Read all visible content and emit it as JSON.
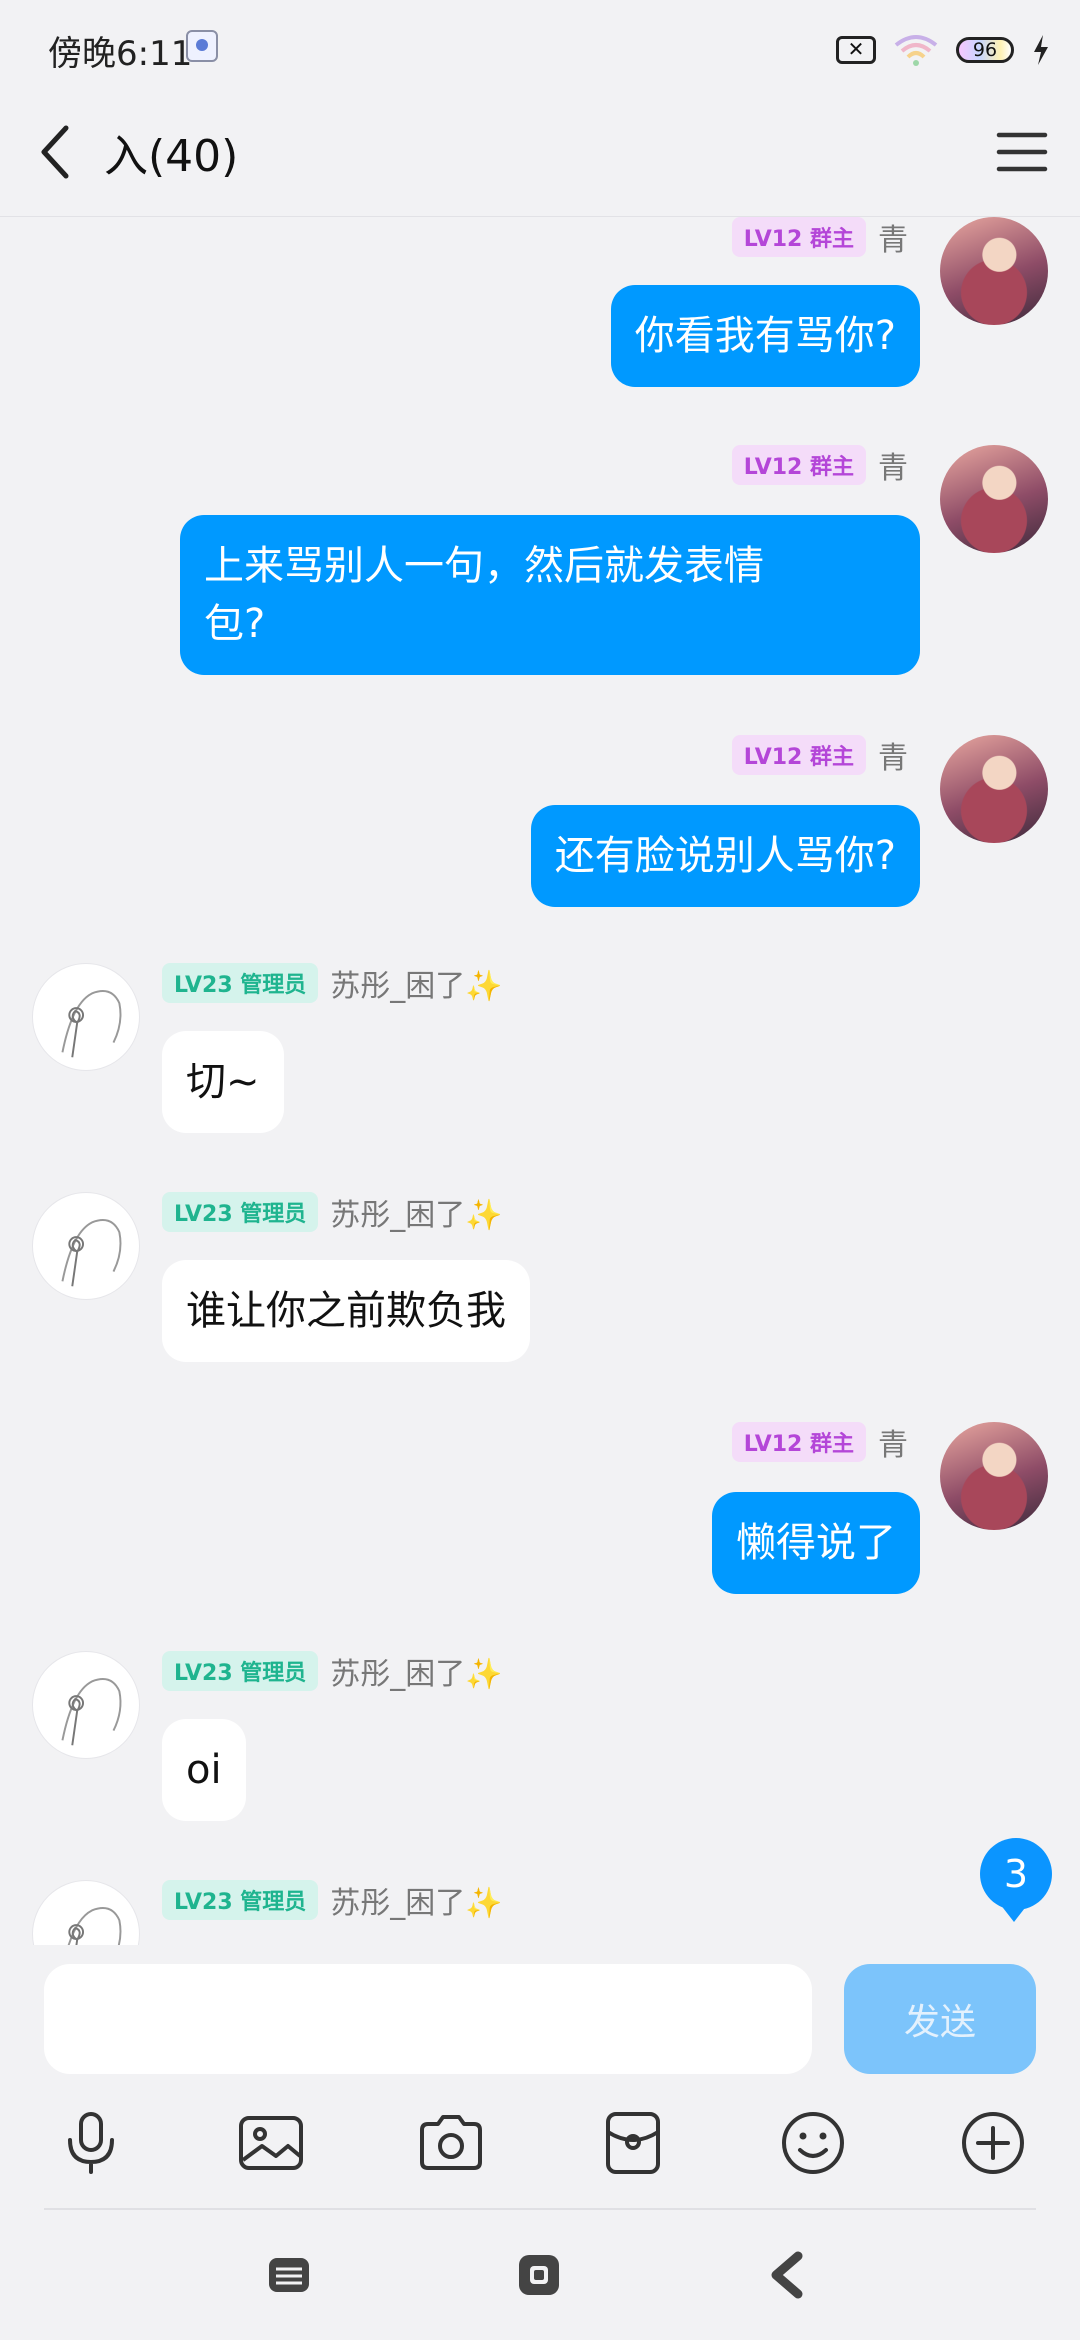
{
  "status": {
    "time": "傍晚6:11",
    "battery": "96"
  },
  "header": {
    "title": "入(40)"
  },
  "messages": [
    {
      "side": "out",
      "badge": "LV12 群主",
      "sender": "青",
      "lines": [
        "你看我有骂你?"
      ]
    },
    {
      "side": "out",
      "badge": "LV12 群主",
      "sender": "青",
      "lines": [
        "上来骂别人一句，然后就发表情",
        "包?"
      ]
    },
    {
      "side": "out",
      "badge": "LV12 群主",
      "sender": "青",
      "lines": [
        "还有脸说别人骂你?"
      ]
    },
    {
      "side": "in",
      "badge": "LV23 管理员",
      "sender": "苏彤_困了✨",
      "lines": [
        "切~"
      ]
    },
    {
      "side": "in",
      "badge": "LV23 管理员",
      "sender": "苏彤_困了✨",
      "lines": [
        "谁让你之前欺负我"
      ]
    },
    {
      "side": "out",
      "badge": "LV12 群主",
      "sender": "青",
      "lines": [
        "懒得说了"
      ]
    },
    {
      "side": "in",
      "badge": "LV23 管理员",
      "sender": "苏彤_困了✨",
      "lines": [
        "oi"
      ]
    },
    {
      "side": "in",
      "badge": "LV23 管理员",
      "sender": "苏彤_困了✨",
      "lines": []
    }
  ],
  "unread_count": "3",
  "input": {
    "value": "",
    "placeholder": ""
  },
  "send_label": "发送",
  "toolbar_icons": [
    "microphone-icon",
    "image-icon",
    "camera-icon",
    "red-packet-icon",
    "emoji-icon",
    "plus-icon"
  ],
  "nav_icons": [
    "recent-apps-icon",
    "home-icon",
    "back-nav-icon"
  ],
  "colors": {
    "outgoing_bubble": "#0099ff",
    "owner_badge_text": "#b446d8",
    "admin_badge_text": "#1fb48f",
    "send_button": "#7cc4fb"
  }
}
